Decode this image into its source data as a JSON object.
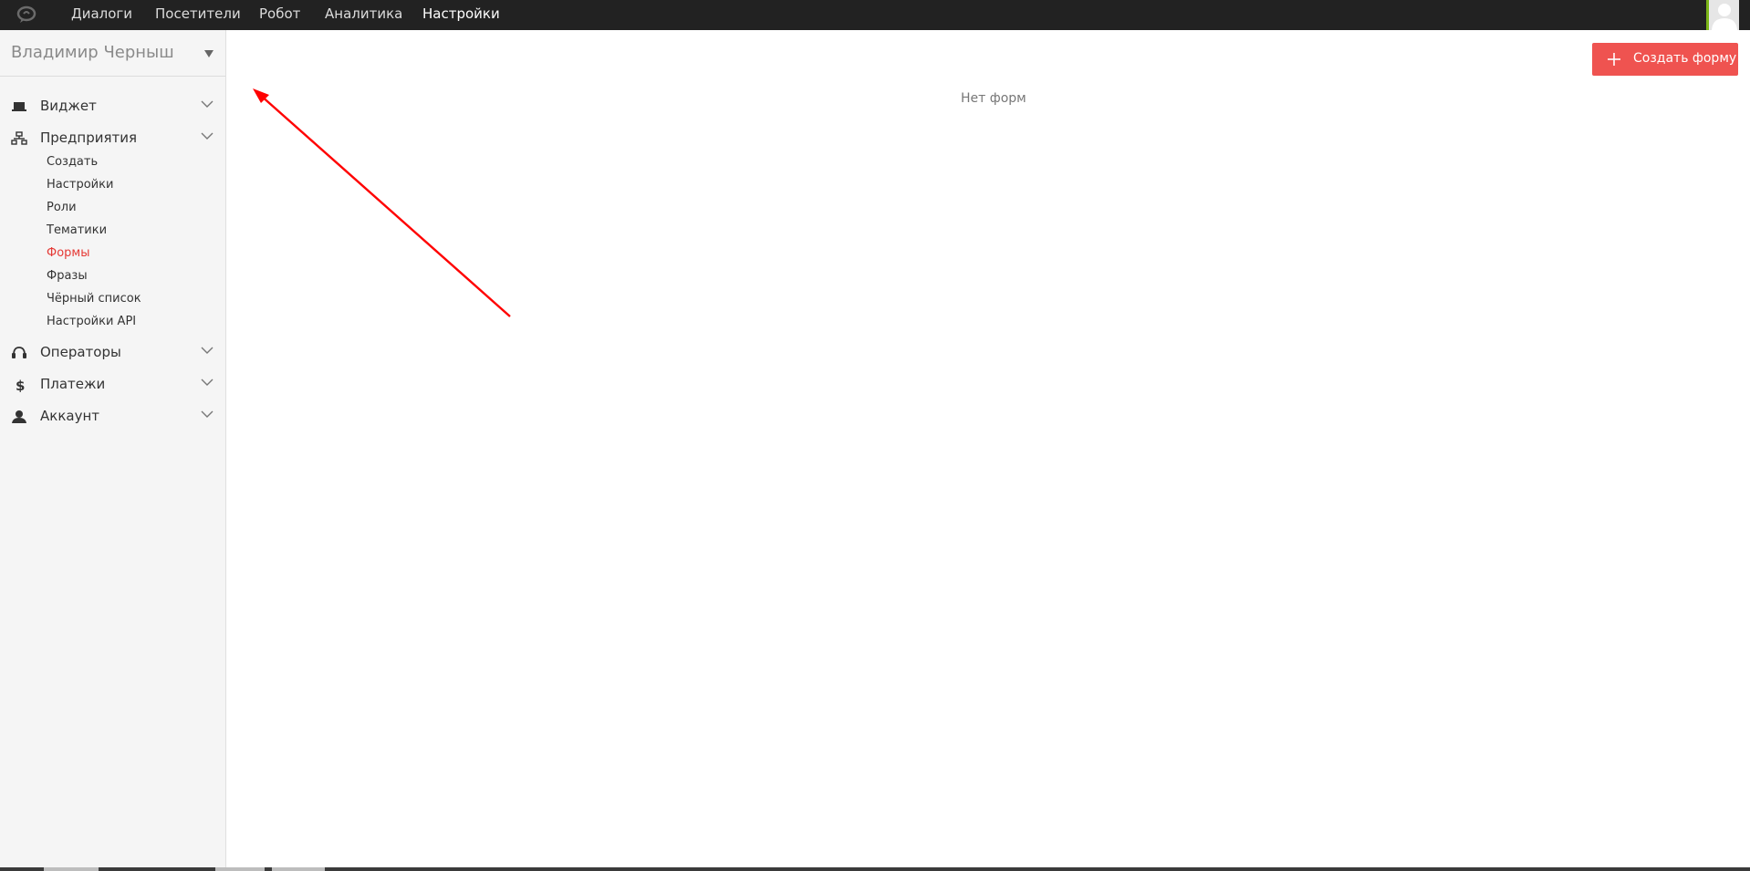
{
  "topnav": {
    "items": [
      {
        "label": "Диалоги",
        "active": false
      },
      {
        "label": "Посетители",
        "active": false
      },
      {
        "label": "Робот",
        "active": false
      },
      {
        "label": "Аналитика",
        "active": false
      },
      {
        "label": "Настройки",
        "active": true
      }
    ],
    "logo_icon": "chat-bubble-logo-icon",
    "avatar_icon": "user-avatar-icon"
  },
  "sidebar": {
    "user_name": "Владимир Черныш",
    "sections": [
      {
        "label": "Виджет",
        "icon": "laptop-icon",
        "expanded": false
      },
      {
        "label": "Предприятия",
        "icon": "sitemap-icon",
        "expanded": true,
        "items": [
          {
            "label": "Создать",
            "active": false
          },
          {
            "label": "Настройки",
            "active": false
          },
          {
            "label": "Роли",
            "active": false
          },
          {
            "label": "Тематики",
            "active": false
          },
          {
            "label": "Формы",
            "active": true
          },
          {
            "label": "Фразы",
            "active": false
          },
          {
            "label": "Чёрный список",
            "active": false
          },
          {
            "label": "Настройки API",
            "active": false
          }
        ]
      },
      {
        "label": "Операторы",
        "icon": "headset-icon",
        "expanded": false
      },
      {
        "label": "Платежи",
        "icon": "dollar-icon",
        "expanded": false
      },
      {
        "label": "Аккаунт",
        "icon": "user-icon",
        "expanded": false
      }
    ]
  },
  "main": {
    "empty_text": "Нет форм",
    "create_button_label": "Создать форму"
  },
  "colors": {
    "topbar": "#222222",
    "accent": "#ef5350",
    "active_link": "#e53935",
    "annotation_arrow": "#ff0000"
  }
}
